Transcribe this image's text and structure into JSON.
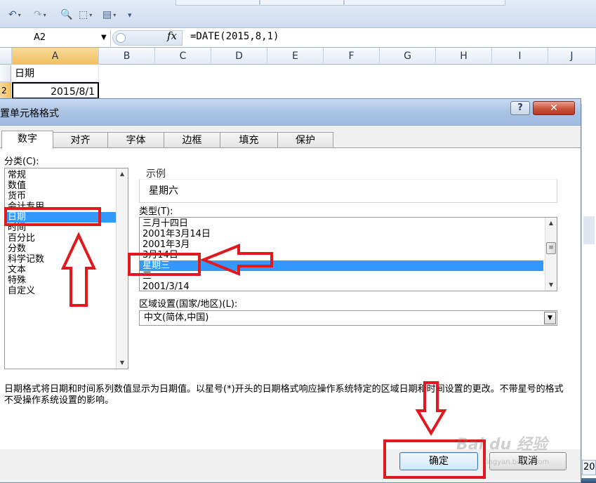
{
  "spreadsheet": {
    "name_box": "A2",
    "fx_label": "fx",
    "formula": "=DATE(2015,8,1)",
    "columns": [
      "A",
      "B",
      "C",
      "D",
      "E",
      "F",
      "G",
      "H",
      "I",
      "J"
    ],
    "cell_a1": "日期",
    "cell_a2": "2015/8/1",
    "row_label_partial": "2",
    "sheet_tab_partial": "20"
  },
  "dialog": {
    "title": "置单元格格式",
    "help_label": "?",
    "close_label": "✕",
    "tabs": [
      "数字",
      "对齐",
      "字体",
      "边框",
      "填充",
      "保护"
    ],
    "active_tab": "数字",
    "category_label": "分类(C):",
    "categories": [
      "常规",
      "数值",
      "货币",
      "会计专用",
      "日期",
      "时间",
      "百分比",
      "分数",
      "科学记数",
      "文本",
      "特殊",
      "自定义"
    ],
    "selected_category": "日期",
    "sample_label": "示例",
    "sample_value": "星期六",
    "type_label": "类型(T):",
    "types": [
      "三月十四日",
      "2001年3月14日",
      "2001年3月",
      "3月14日",
      "星期三",
      "三",
      "2001/3/14"
    ],
    "selected_type": "星期三",
    "locale_label": "区域设置(国家/地区)(L):",
    "locale_value": "中文(简体,中国)",
    "description": "日期格式将日期和时间系列数值显示为日期值。以星号(*)开头的日期格式响应操作系统特定的区域日期和时间设置的更改。不带星号的格式不受操作系统设置的影响。",
    "ok_label": "确定",
    "cancel_label": "取消"
  },
  "annotation_color": "#e0191e",
  "watermark": {
    "line1": "Bai du 经验",
    "line2": "jingyan.baidu.com"
  }
}
